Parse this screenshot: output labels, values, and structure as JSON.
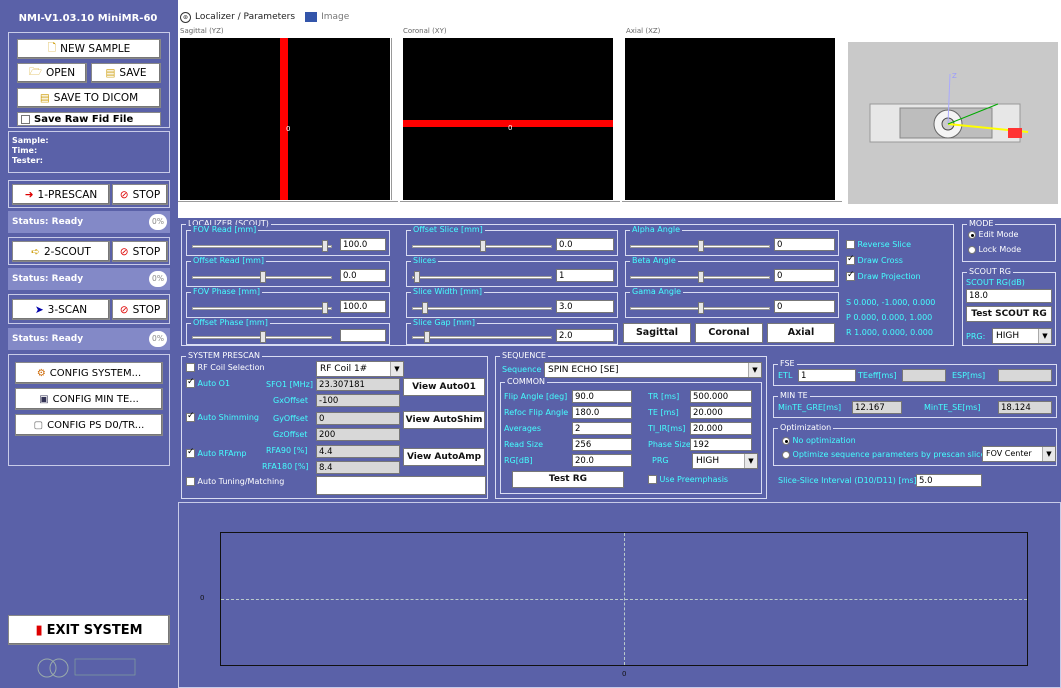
{
  "app_title": "NMI-V1.03.10  MiniMR-60",
  "sample_buttons": {
    "new_sample": "NEW SAMPLE",
    "open": "OPEN",
    "save": "SAVE",
    "save_dicom": "SAVE TO DICOM",
    "save_raw": "Save Raw Fid File"
  },
  "info": {
    "sample": "Sample:",
    "time": "Time:",
    "tester": "Tester:"
  },
  "steps": [
    {
      "label": "1-PRESCAN",
      "stop": "STOP",
      "status": "Status: Ready",
      "pct": "0%"
    },
    {
      "label": "2-SCOUT",
      "stop": "STOP",
      "status": "Status: Ready",
      "pct": "0%"
    },
    {
      "label": "3-SCAN",
      "stop": "STOP",
      "status": "Status: Ready",
      "pct": "0%"
    }
  ],
  "config": {
    "system": "CONFIG SYSTEM...",
    "min_te": "CONFIG MIN TE...",
    "ps": "CONFIG PS D0/TR..."
  },
  "exit": "EXIT SYSTEM",
  "tabs": {
    "localizer": "Localizer / Parameters",
    "image": "Image"
  },
  "views": {
    "sagittal": "Sagittal (YZ)",
    "coronal": "Coronal (XY)",
    "axial": "Axial (XZ)"
  },
  "view_marks": {
    "zero": "0",
    "z": "Z"
  },
  "localizer": {
    "title": "LOCALIZER (SCOUT)",
    "fov_read": {
      "label": "FOV Read [mm]",
      "value": "100.0"
    },
    "offset_read": {
      "label": "Offset Read [mm]",
      "value": "0.0"
    },
    "fov_phase": {
      "label": "FOV Phase [mm]",
      "value": "100.0"
    },
    "offset_phase": {
      "label": "Offset Phase [mm]",
      "value": ""
    },
    "offset_slice": {
      "label": "Offset Slice [mm]",
      "value": "0.0"
    },
    "slices": {
      "label": "Slices",
      "value": "1"
    },
    "slice_width": {
      "label": "Slice Width [mm]",
      "value": "3.0"
    },
    "slice_gap": {
      "label": "Slice Gap [mm]",
      "value": "2.0"
    },
    "alpha": {
      "label": "Alpha Angle",
      "value": "0"
    },
    "beta": {
      "label": "Beta Angle",
      "value": "0"
    },
    "gama": {
      "label": "Gama Angle",
      "value": "0"
    },
    "reverse_slice": "Reverse Slice",
    "draw_cross": "Draw Cross",
    "draw_projection": "Draw Projection",
    "s_vec": "S  0.000, -1.000, 0.000",
    "p_vec": "P  0.000, 0.000, 1.000",
    "r_vec": "R  1.000, 0.000, 0.000",
    "btn_sagittal": "Sagittal",
    "btn_coronal": "Coronal",
    "btn_axial": "Axial"
  },
  "mode": {
    "title": "MODE",
    "edit": "Edit Mode",
    "lock": "Lock Mode"
  },
  "scout_rg": {
    "title": "SCOUT RG",
    "label": "SCOUT RG(dB)",
    "value": "18.0",
    "test": "Test SCOUT RG",
    "prg_label": "PRG:",
    "prg_value": "HIGH"
  },
  "prescan": {
    "title": "SYSTEM PRESCAN",
    "rf_coil_label": "RF Coil Selection",
    "rf_coil_value": "RF Coil 1#",
    "auto_o1": "Auto O1",
    "sfo1_label": "SFO1 [MHz]",
    "sfo1_value": "23.307181",
    "gx_label": "GxOffset",
    "gx_value": "-100",
    "auto_shim": "Auto Shimming",
    "gy_label": "GyOffset",
    "gy_value": "0",
    "gz_label": "GzOffset",
    "gz_value": "200",
    "auto_rfamp": "Auto RFAmp",
    "rfa90_label": "RFA90 [%]",
    "rfa90_value": "4.4",
    "rfa180_label": "RFA180 [%]",
    "rfa180_value": "8.4",
    "auto_tuning": "Auto Tuning/Matching",
    "auto_tuning_value": "",
    "view_auto01": "View Auto01",
    "view_autoshim": "View AutoShim",
    "view_autoamp": "View AutoAmp"
  },
  "sequence": {
    "title": "SEQUENCE",
    "label": "Sequence",
    "value": "SPIN ECHO [SE]",
    "common_title": "COMMON",
    "flip_label": "Flip Angle [deg]",
    "flip_value": "90.0",
    "refoc_label": "Refoc Flip Angle",
    "refoc_value": "180.0",
    "averages_label": "Averages",
    "averages_value": "2",
    "read_label": "Read Size",
    "read_value": "256",
    "rg_label": "RG[dB]",
    "rg_value": "20.0",
    "tr_label": "TR [ms]",
    "tr_value": "500.000",
    "te_label": "TE [ms]",
    "te_value": "20.000",
    "tiir_label": "TI_IR[ms]",
    "tiir_value": "20.000",
    "phase_label": "Phase Size",
    "phase_value": "192",
    "prg_label": "PRG",
    "prg_value": "HIGH",
    "test_rg": "Test RG",
    "use_preemphasis": "Use Preemphasis"
  },
  "fse": {
    "title": "FSE",
    "etl_label": "ETL",
    "etl_value": "1",
    "teeff_label": "TEeff[ms]",
    "teeff_value": "",
    "esp_label": "ESP[ms]",
    "esp_value": ""
  },
  "minte": {
    "title": "MIN TE",
    "gre_label": "MinTE_GRE[ms]",
    "gre_value": "12.167",
    "se_label": "MinTE_SE[ms]",
    "se_value": "18.124"
  },
  "optimization": {
    "title": "Optimization",
    "no_opt": "No optimization",
    "opt_prescan": "Optimize sequence parameters by prescan slice",
    "fov_center": "FOV Center"
  },
  "slice_interval": {
    "label": "Slice-Slice Interval (D10/D11) [ms]",
    "value": "5.0"
  },
  "plot": {
    "y_tick": "0",
    "x_tick": "0"
  },
  "colors": {
    "panel": "#5a61a8",
    "cross": "#ff0000",
    "label": "#44ffff"
  }
}
